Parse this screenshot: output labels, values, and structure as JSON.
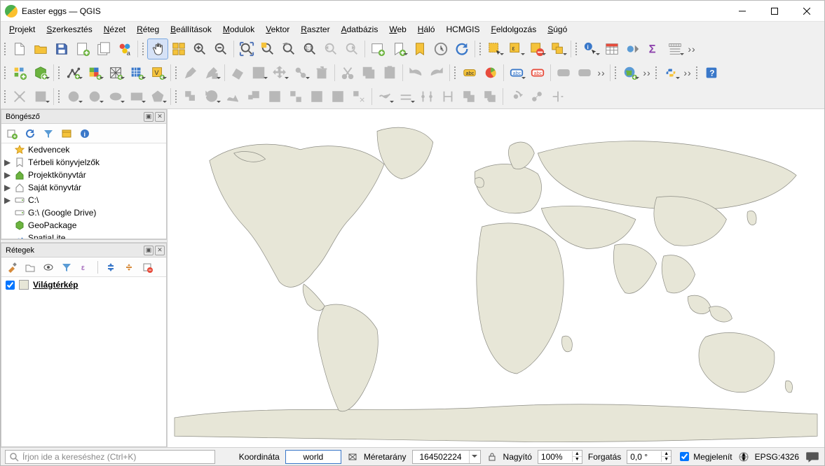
{
  "window": {
    "title": "Easter eggs — QGIS"
  },
  "menu": [
    {
      "label": "Projekt",
      "u": 0
    },
    {
      "label": "Szerkesztés",
      "u": 0
    },
    {
      "label": "Nézet",
      "u": 0
    },
    {
      "label": "Réteg",
      "u": 0
    },
    {
      "label": "Beállítások",
      "u": 0
    },
    {
      "label": "Modulok",
      "u": 0
    },
    {
      "label": "Vektor",
      "u": 0
    },
    {
      "label": "Raszter",
      "u": 0
    },
    {
      "label": "Adatbázis",
      "u": 0
    },
    {
      "label": "Web",
      "u": 0
    },
    {
      "label": "Háló",
      "u": 0
    },
    {
      "label": "HCMGIS",
      "u": -1
    },
    {
      "label": "Feldolgozás",
      "u": 0
    },
    {
      "label": "Súgó",
      "u": 0
    }
  ],
  "panels": {
    "browser_title": "Böngésző",
    "layers_title": "Rétegek"
  },
  "browser_items": [
    {
      "icon": "star",
      "label": "Kedvencek",
      "exp": ""
    },
    {
      "icon": "bookmark",
      "label": "Térbeli könyvjelzők",
      "exp": "▶"
    },
    {
      "icon": "home-green",
      "label": "Projektkönyvtár",
      "exp": "▶"
    },
    {
      "icon": "home",
      "label": "Saját könyvtár",
      "exp": "▶"
    },
    {
      "icon": "drive",
      "label": "C:\\",
      "exp": "▶"
    },
    {
      "icon": "drive",
      "label": "G:\\ (Google Drive)",
      "exp": ""
    },
    {
      "icon": "geopackage",
      "label": "GeoPackage",
      "exp": ""
    },
    {
      "icon": "spatialite",
      "label": "SpatiaLite",
      "exp": ""
    }
  ],
  "layers": [
    {
      "name": "Világtérkép",
      "checked": true
    }
  ],
  "status": {
    "search_placeholder": "Írjon ide a kereséshez (Ctrl+K)",
    "coord_label": "Koordináta",
    "coord_value": "world",
    "scale_label": "Méretarány",
    "scale_value": "164502224",
    "mag_label": "Nagyító",
    "mag_value": "100%",
    "rot_label": "Forgatás",
    "rot_value": "0,0 °",
    "render_label": "Megjelenít",
    "render_checked": true,
    "crs_label": "EPSG:4326"
  }
}
